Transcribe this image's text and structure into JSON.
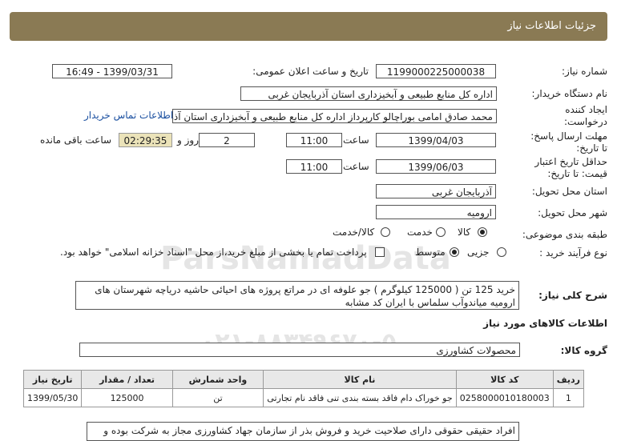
{
  "header": {
    "title": "جزئیات اطلاعات نیاز"
  },
  "fields": {
    "need_number_label": "شماره نیاز:",
    "need_number": "1199000225000038",
    "announce_label": "تاریخ و ساعت اعلان عمومی:",
    "announce_value": "1399/03/31 - 16:49",
    "buyer_label": "نام دستگاه خریدار:",
    "buyer_value": "اداره کل منابع طبیعی و آبخیزداری استان آذربایجان غربی",
    "creator_label_1": "ایجاد کننده",
    "creator_label_2": "درخواست:",
    "creator_value": "محمد صادق امامی بوراچالو کارپرداز اداره کل منابع طبیعی و آبخیزداری استان آذر",
    "contact_link": "اطلاعات تماس خریدار",
    "deadline_label_1": "مهلت ارسال پاسخ:",
    "deadline_label_2": "تا تاریخ:",
    "deadline_date": "1399/04/03",
    "hour_label": "ساعت",
    "deadline_time": "11:00",
    "days_value": "2",
    "days_label": "روز و",
    "timer_value": "02:29:35",
    "remaining_label": "ساعت باقی مانده",
    "validity_label_1": "حداقل تاریخ اعتبار",
    "validity_label_2": "قیمت: تا تاریخ:",
    "validity_date": "1399/06/03",
    "validity_time": "11:00",
    "province_label": "استان محل تحویل:",
    "province_value": "آذربایجان غربی",
    "city_label": "شهر محل تحویل:",
    "city_value": "ارومیه",
    "category_label": "طبقه بندی موضوعی:",
    "category_options": [
      "کالا",
      "خدمت",
      "کالا/خدمت"
    ],
    "process_label": "نوع فرآیند خرید :",
    "process_options": [
      "جزیی",
      "متوسط"
    ],
    "payment_text": "پرداخت تمام یا بخشی از مبلغ خرید،از محل \"اسناد خزانه اسلامی\" خواهد بود."
  },
  "description": {
    "label": "شرح کلی نیاز:",
    "text": "خرید 125 تن ( 125000 کیلوگرم ) جو علوفه ای در مراتع پروژه های احیائی حاشیه دریاچه شهرستان های ارومیه میاندوآب سلماس با ایران کد مشابه"
  },
  "goods_section": {
    "title": "اطلاعات کالاهای مورد نیاز",
    "group_label": "گروه کالا:",
    "group_value": "محصولات کشاورزی"
  },
  "table": {
    "headers": [
      "ردیف",
      "کد کالا",
      "نام کالا",
      "واحد شمارش",
      "تعداد / مقدار",
      "تاریخ نیاز"
    ],
    "rows": [
      [
        "1",
        "0258000010180003",
        "جو خوراک دام فاقد بسته بندی تنی فاقد نام تجارتی",
        "تن",
        "125000",
        "1399/05/30"
      ]
    ]
  },
  "footer_note": "افراد حقیقی حقوقی دارای صلاحیت خرید و فروش بذر از سازمان جهاد کشاورزی مجاز به شرکت بوده و",
  "watermark": {
    "line1": "ParsNamadData",
    "line2": "۰۲۱-۸۸۳۴۹۶۷۰-۵"
  }
}
